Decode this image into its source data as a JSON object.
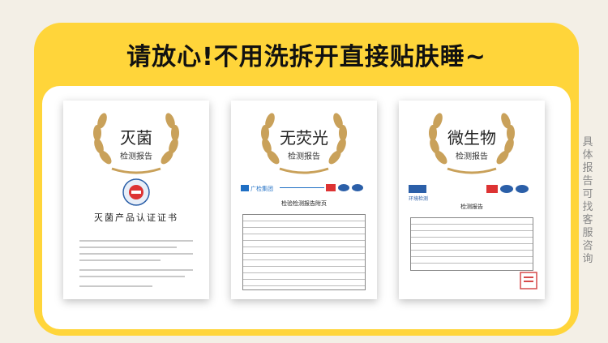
{
  "headline": "请放心!不用洗拆开直接贴肤睡~",
  "side_note": "具体报告可找客服咨询",
  "colors": {
    "frame": "#ffd53a",
    "background": "#f3efe6",
    "gold": "#c9a15a"
  },
  "cards": [
    {
      "title": "灭菌",
      "subtitle": "检测报告",
      "doc_heading": "灭菌产品认证证书"
    },
    {
      "title": "无荧光",
      "subtitle": "检测报告",
      "logo_text": "广检集团",
      "doc_heading": "检验检测报告附页"
    },
    {
      "title": "微生物",
      "subtitle": "检测报告",
      "logo_text": "环境检测",
      "doc_heading": "检测报告"
    }
  ]
}
